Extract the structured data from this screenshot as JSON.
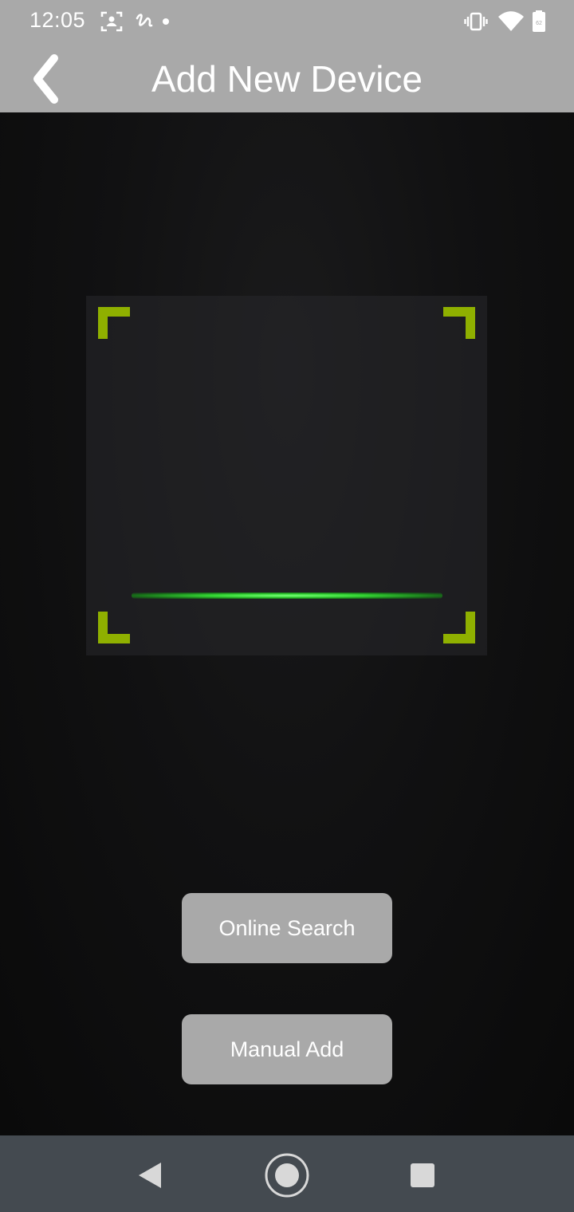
{
  "status_bar": {
    "time": "12:05",
    "icons": [
      "face-scan-icon",
      "handwriting-icon",
      "notification-dot-icon",
      "vibrate-icon",
      "wifi-icon",
      "battery-icon"
    ]
  },
  "header": {
    "title": "Add New Device",
    "back_icon": "chevron-left-icon"
  },
  "scanner": {
    "corner_color": "#8fb000",
    "scan_line_color": "#34d634"
  },
  "buttons": {
    "online_search": "Online Search",
    "manual_add": "Manual Add"
  },
  "navigation": {
    "back": "back-triangle-icon",
    "home": "home-circle-icon",
    "recents": "recents-square-icon"
  },
  "colors": {
    "bar_grey": "#a9a9a9",
    "nav_bg": "#444a50"
  }
}
